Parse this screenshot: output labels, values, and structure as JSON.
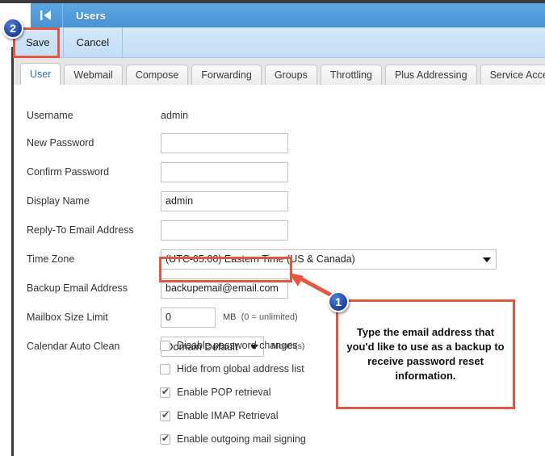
{
  "window": {
    "title": "Users",
    "collapse_icon": "collapse-left-icon"
  },
  "toolbar": {
    "save_label": "Save",
    "cancel_label": "Cancel"
  },
  "tabs": [
    {
      "label": "User",
      "active": true
    },
    {
      "label": "Webmail",
      "active": false
    },
    {
      "label": "Compose",
      "active": false
    },
    {
      "label": "Forwarding",
      "active": false
    },
    {
      "label": "Groups",
      "active": false
    },
    {
      "label": "Throttling",
      "active": false
    },
    {
      "label": "Plus Addressing",
      "active": false
    },
    {
      "label": "Service Access",
      "active": false
    }
  ],
  "form": {
    "username": {
      "label": "Username",
      "value": "admin"
    },
    "new_password": {
      "label": "New Password",
      "value": "",
      "placeholder": ""
    },
    "confirm_password": {
      "label": "Confirm Password",
      "value": "",
      "placeholder": ""
    },
    "display_name": {
      "label": "Display Name",
      "value": "admin",
      "placeholder": ""
    },
    "reply_to": {
      "label": "Reply-To Email Address",
      "value": "",
      "placeholder": ""
    },
    "time_zone": {
      "label": "Time Zone",
      "value": "(UTC-05:00) Eastern Time (US & Canada)"
    },
    "backup_email": {
      "label": "Backup Email Address",
      "value": "backupemail@email.com",
      "placeholder": ""
    },
    "mailbox_size": {
      "label": "Mailbox Size Limit",
      "value": "0",
      "unit": "MB",
      "hint": "(0 = unlimited)"
    },
    "calendar_auto_clean": {
      "label": "Calendar Auto Clean",
      "value": "Domain Default",
      "unit": "Month(s)"
    }
  },
  "checkboxes": [
    {
      "label": "Disable password changes",
      "checked": false
    },
    {
      "label": "Hide from global address list",
      "checked": false
    },
    {
      "label": "Enable POP retrieval",
      "checked": true
    },
    {
      "label": "Enable IMAP Retrieval",
      "checked": true
    },
    {
      "label": "Enable outgoing mail signing",
      "checked": true
    }
  ],
  "annotations": {
    "callout_text": "Type the email address that you'd like to use as a backup to receive password reset information.",
    "badge_one": "1",
    "badge_two": "2",
    "highlight_color": "#e2573f",
    "badge_color": "#1b3f9e"
  },
  "colors": {
    "titlebar": "#4a93d4",
    "toolbar": "#c3ddf6",
    "tab_active_text": "#2f6fa8",
    "page_border": "#3b3b3f"
  }
}
